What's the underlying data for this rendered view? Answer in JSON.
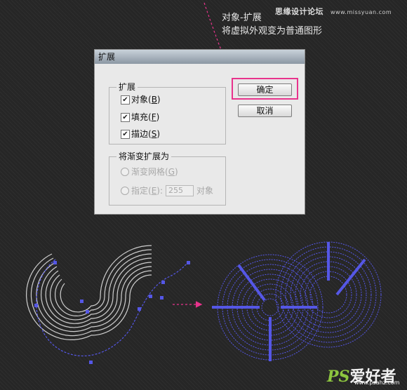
{
  "watermark": {
    "site_cn": "思缘设计论坛",
    "site_url": "www.missyuan.com"
  },
  "annotation": {
    "line1": "对象-扩展",
    "line2": "将虚拟外观变为普通图形"
  },
  "dialog": {
    "title": "扩展",
    "expand_group": {
      "legend": "扩展",
      "items": [
        {
          "label": "对象(",
          "key": "B",
          "close": ")",
          "checked": true
        },
        {
          "label": "填充(",
          "key": "F",
          "close": ")",
          "checked": true
        },
        {
          "label": "描边(",
          "key": "S",
          "close": ")",
          "checked": true
        }
      ]
    },
    "gradient_group": {
      "legend": "将渐变扩展为",
      "gradient_mesh": {
        "label": "渐变网格(",
        "key": "G",
        "close": ")"
      },
      "specify": {
        "label": "指定(",
        "key": "E",
        "close": "):",
        "value": "255",
        "unit": "对象"
      }
    },
    "ok_label": "确定",
    "cancel_label": "取消"
  },
  "logo": {
    "ps": "PS",
    "text": "爱好者",
    "url": "www.psahz.com"
  },
  "colors": {
    "accent_pink": "#e8338c",
    "path_blue": "#5557e6",
    "dialog_bg": "#e9e9e9"
  }
}
